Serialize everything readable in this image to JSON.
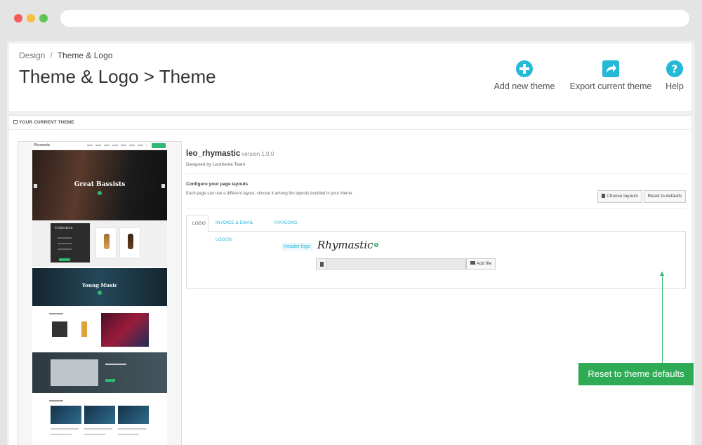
{
  "breadcrumb": {
    "parent": "Design",
    "separator": "/",
    "current": "Theme & Logo"
  },
  "page": {
    "title": "Theme & Logo > Theme"
  },
  "toolbar": {
    "add_label": "Add new theme",
    "export_label": "Export current theme",
    "help_label": "Help",
    "icon_color": "#25b9d7"
  },
  "panel": {
    "heading": "YOUR CURRENT THEME"
  },
  "preview": {
    "hero_title": "Great Bassists",
    "collection_label": "Collection",
    "band_title": "Young Music"
  },
  "theme": {
    "name": "leo_rhymastic",
    "version": "version 1.0.0",
    "designer": "Designed by Leotheme Team"
  },
  "layouts": {
    "title": "Configure your page layouts",
    "description": "Each page can use a different layout, choose it among the layouts bundled in your theme.",
    "choose_label": "Choose layouts",
    "reset_label": "Reset to defaults"
  },
  "tabs": [
    {
      "label": "LOGO",
      "active": true
    },
    {
      "label": "INVOICE & EMAIL LOGOS",
      "active": false
    },
    {
      "label": "FAVICONS",
      "active": false
    }
  ],
  "logo_tab": {
    "header_logo_label": "Header logo",
    "logo_text": "Rhymastic",
    "add_file_label": "Add file"
  },
  "callout": {
    "text": "Reset to theme defaults",
    "color": "#2fab55"
  }
}
